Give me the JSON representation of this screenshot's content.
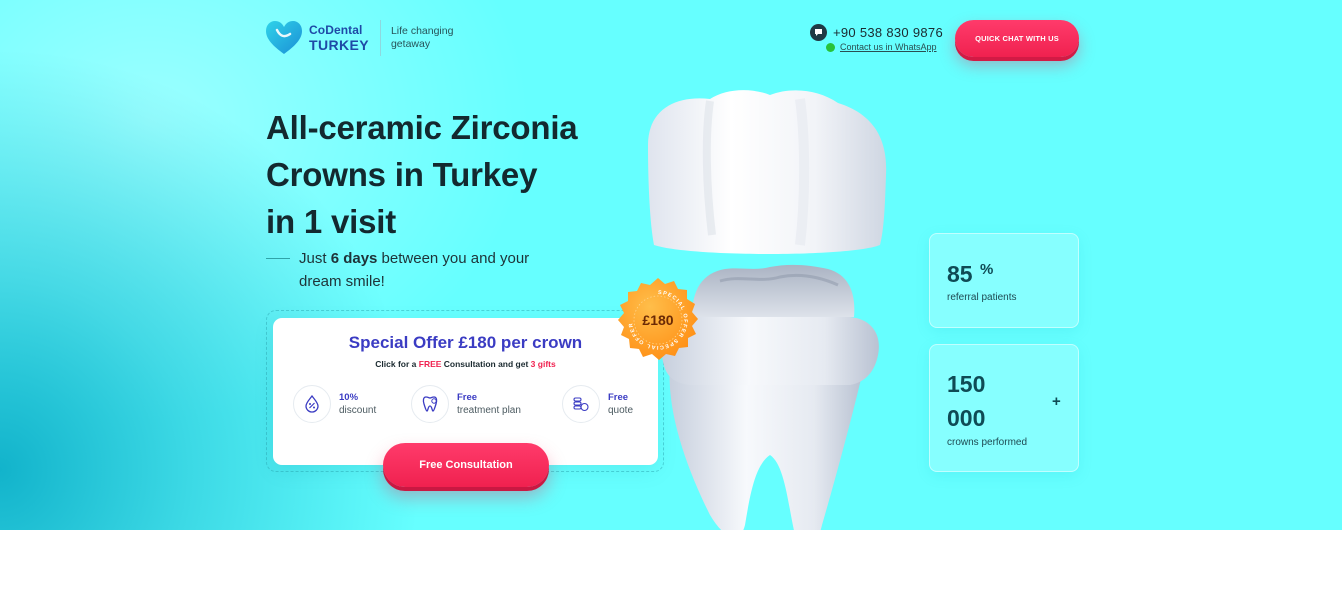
{
  "header": {
    "brand_line1": "CoDental",
    "brand_line2": "TURKEY",
    "tagline": "Life changing getaway",
    "phone": "+90 538 830 9876",
    "whatsapp_link": "Contact us in WhatsApp",
    "quick_chat_label": "QUICK CHAT WITH US"
  },
  "hero": {
    "headline_line1": "All-ceramic Zirconia",
    "headline_line2": "Crowns in Turkey",
    "headline_line3": "in 1 visit",
    "sub_prefix": "Just ",
    "sub_bold": "6 days",
    "sub_suffix": " between you and your dream smile!"
  },
  "offer": {
    "title": "Special Offer £180 per crown",
    "sub_prefix": "Click for a ",
    "sub_free": "FREE",
    "sub_middle": " Consultation and get ",
    "sub_gifts": "3 gifts",
    "benefits": [
      {
        "top": "10%",
        "bottom": "discount",
        "icon": "discount-icon"
      },
      {
        "top": "Free",
        "bottom": "treatment plan",
        "icon": "tooth-icon"
      },
      {
        "top": "Free",
        "bottom": "quote",
        "icon": "coins-icon"
      }
    ],
    "cta_label": "Free Consultation"
  },
  "badge": {
    "price": "£180",
    "ring_text": "SPECIAL OFFER SPECIAL OFFER"
  },
  "stats": [
    {
      "value": "85",
      "suffix": "%",
      "label": "referral patients"
    },
    {
      "value_line1": "150",
      "value_line2": "000",
      "suffix": "+",
      "label": "crowns performed"
    }
  ],
  "colors": {
    "background": "#66ffff",
    "accent_red": "#f0214f",
    "brand_blue": "#3b3cc3",
    "badge_orange": "#ff9a1f"
  }
}
